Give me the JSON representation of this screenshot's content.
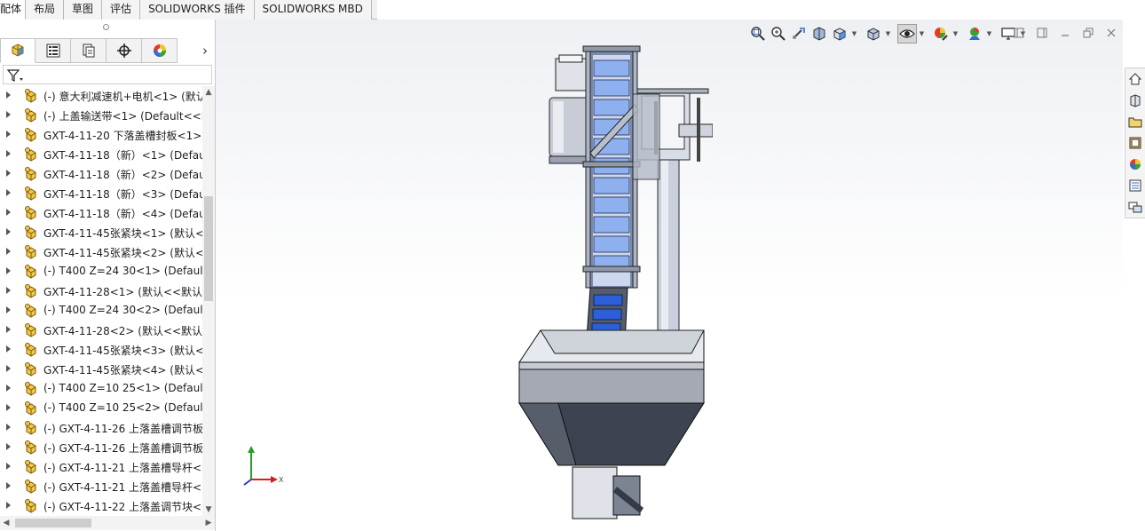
{
  "tabs": [
    {
      "label": "装配体",
      "visible_label": "配体",
      "active": true
    },
    {
      "label": "布局"
    },
    {
      "label": "草图"
    },
    {
      "label": "评估"
    },
    {
      "label": "SOLIDWORKS 插件"
    },
    {
      "label": "SOLIDWORKS MBD"
    }
  ],
  "feature_tree": {
    "items": [
      {
        "label": "(-) 意大利减速机+电机<1> (默认<"
      },
      {
        "label": "(-) 上盖输送带<1> (Default<<D"
      },
      {
        "label": "GXT-4-11-20 下落盖槽封板<1> "
      },
      {
        "label": "GXT-4-11-18（新）<1> (Defau"
      },
      {
        "label": "GXT-4-11-18（新）<2> (Defau"
      },
      {
        "label": "GXT-4-11-18（新）<3> (Defau"
      },
      {
        "label": "GXT-4-11-18（新）<4> (Defau"
      },
      {
        "label": "GXT-4-11-45张紧块<1> (默认<"
      },
      {
        "label": "GXT-4-11-45张紧块<2> (默认<"
      },
      {
        "label": "(-) T400 Z=24 30<1> (Default<"
      },
      {
        "label": "GXT-4-11-28<1> (默认<<默认>"
      },
      {
        "label": "(-) T400 Z=24 30<2> (Default<"
      },
      {
        "label": "GXT-4-11-28<2> (默认<<默认>"
      },
      {
        "label": "GXT-4-11-45张紧块<3> (默认<"
      },
      {
        "label": "GXT-4-11-45张紧块<4> (默认<"
      },
      {
        "label": "(-) T400 Z=10 25<1> (Default<"
      },
      {
        "label": "(-) T400 Z=10 25<2> (Default<"
      },
      {
        "label": "(-) GXT-4-11-26 上落盖槽调节板"
      },
      {
        "label": "(-) GXT-4-11-26 上落盖槽调节板"
      },
      {
        "label": "(-) GXT-4-11-21 上落盖槽导杆<"
      },
      {
        "label": "(-) GXT-4-11-21 上落盖槽导杆<"
      },
      {
        "label": "(-) GXT-4-11-22 上落盖调节块<"
      }
    ]
  },
  "manager_tabs": [
    "feature-manager",
    "property-manager",
    "configuration-manager",
    "dimxpert-manager",
    "display-manager"
  ],
  "headsup_toolbar": [
    "zoom-to-fit",
    "zoom-to-area",
    "previous-view",
    "section-view",
    "view-orientation",
    "display-style",
    "hide-show-items",
    "edit-appearance",
    "apply-scene",
    "view-settings"
  ],
  "task_pane": [
    "solidworks-resources",
    "design-library",
    "file-explorer",
    "view-palette",
    "appearances-scenes",
    "custom-properties",
    "forum"
  ],
  "triad": {
    "x_label": "X",
    "y_label": "Y"
  },
  "colors": {
    "accent": "#1e6fd9",
    "part_icon": "#e8b423",
    "belt": "#3a6fe0"
  }
}
